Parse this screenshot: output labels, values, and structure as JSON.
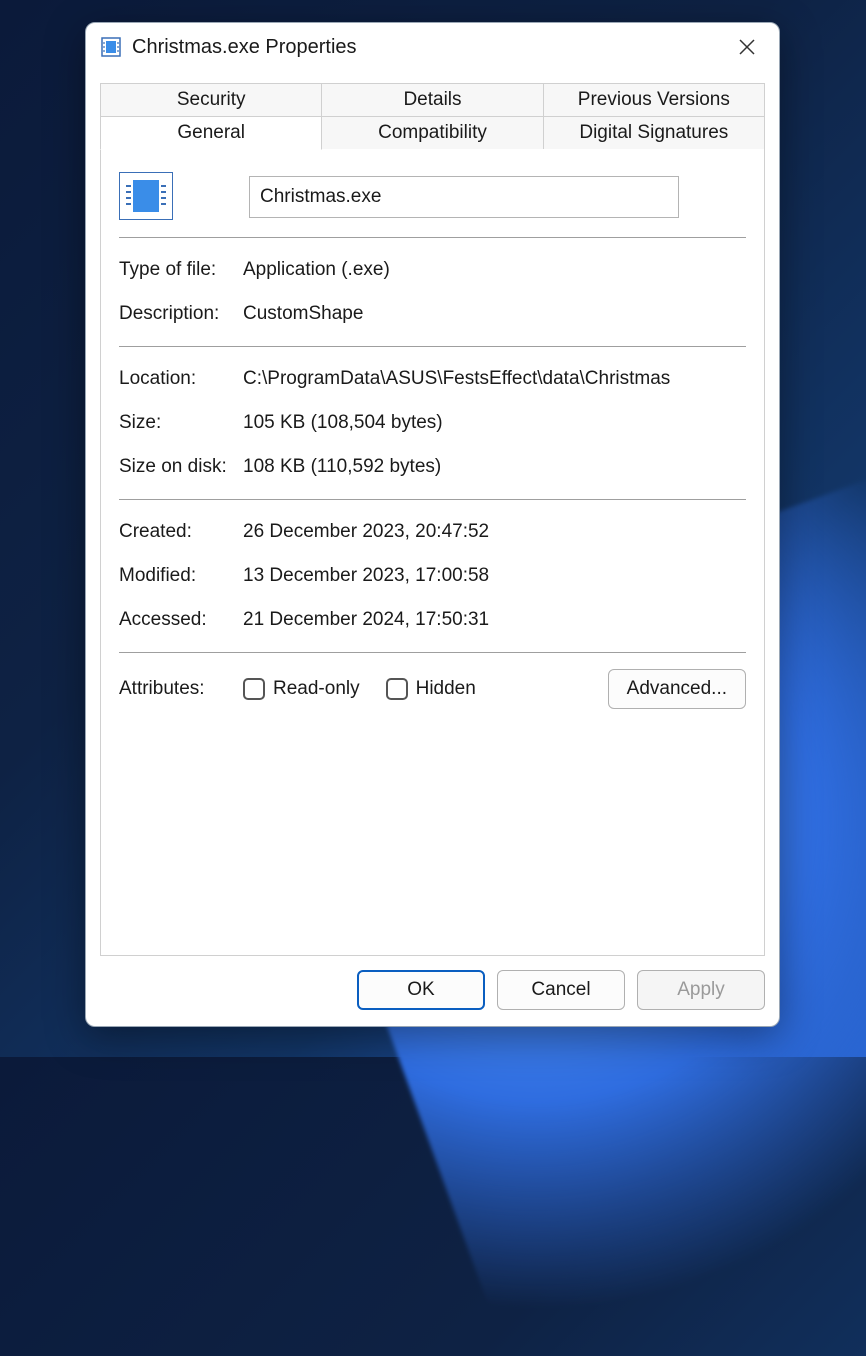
{
  "window": {
    "title": "Christmas.exe Properties"
  },
  "tabs": {
    "row1": [
      "Security",
      "Details",
      "Previous Versions"
    ],
    "row2": [
      "General",
      "Compatibility",
      "Digital Signatures"
    ],
    "active": "General"
  },
  "general": {
    "filename": "Christmas.exe",
    "labels": {
      "type_of_file": "Type of file:",
      "description": "Description:",
      "location": "Location:",
      "size": "Size:",
      "size_on_disk": "Size on disk:",
      "created": "Created:",
      "modified": "Modified:",
      "accessed": "Accessed:",
      "attributes": "Attributes:"
    },
    "values": {
      "type_of_file": "Application (.exe)",
      "description": "CustomShape",
      "location": "C:\\ProgramData\\ASUS\\FestsEffect\\data\\Christmas",
      "size": "105 KB (108,504 bytes)",
      "size_on_disk": "108 KB (110,592 bytes)",
      "created": "26 December 2023, 20:47:52",
      "modified": "13 December 2023, 17:00:58",
      "accessed": "21 December 2024, 17:50:31"
    },
    "attributes": {
      "read_only_label": "Read-only",
      "read_only_checked": false,
      "hidden_label": "Hidden",
      "hidden_checked": false,
      "advanced_label": "Advanced..."
    }
  },
  "buttons": {
    "ok": "OK",
    "cancel": "Cancel",
    "apply": "Apply"
  }
}
